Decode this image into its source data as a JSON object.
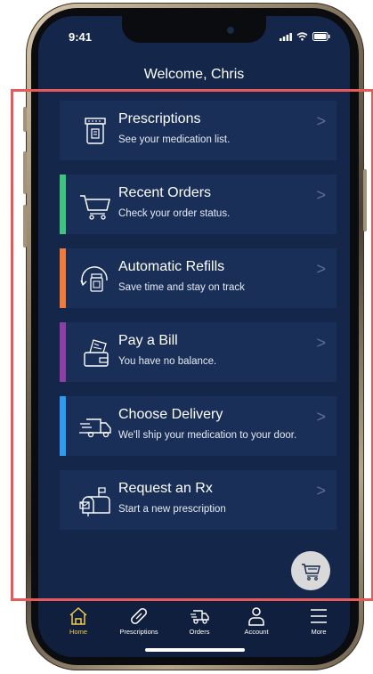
{
  "status": {
    "time": "9:41"
  },
  "header": {
    "welcome": "Welcome, Chris"
  },
  "cards": [
    {
      "title": "Prescriptions",
      "subtitle": "See your medication list.",
      "accent": ""
    },
    {
      "title": "Recent Orders",
      "subtitle": "Check your order status.",
      "accent": "#3fc380"
    },
    {
      "title": "Automatic Refills",
      "subtitle": "Save time and stay on track",
      "accent": "#f07a3a"
    },
    {
      "title": "Pay a Bill",
      "subtitle": "You have no balance.",
      "accent": "#8e3fa6"
    },
    {
      "title": "Choose Delivery",
      "subtitle": "We'll ship your medication to your door.",
      "accent": "#2d9cf0"
    },
    {
      "title": "Request an Rx",
      "subtitle": "Start a new prescription",
      "accent": ""
    }
  ],
  "chevron": ">",
  "tabs": [
    {
      "label": "Home",
      "icon": "home-icon",
      "active": true
    },
    {
      "label": "Prescriptions",
      "icon": "pill-icon",
      "active": false
    },
    {
      "label": "Orders",
      "icon": "delivery-truck-icon",
      "active": false
    },
    {
      "label": "Account",
      "icon": "person-icon",
      "active": false
    },
    {
      "label": "More",
      "icon": "menu-icon",
      "active": false
    }
  ],
  "colors": {
    "screen_background": "#14264a",
    "card_background": "#1a2f58",
    "active_tab": "#f2c94c",
    "highlight_border": "#e65a5a"
  }
}
